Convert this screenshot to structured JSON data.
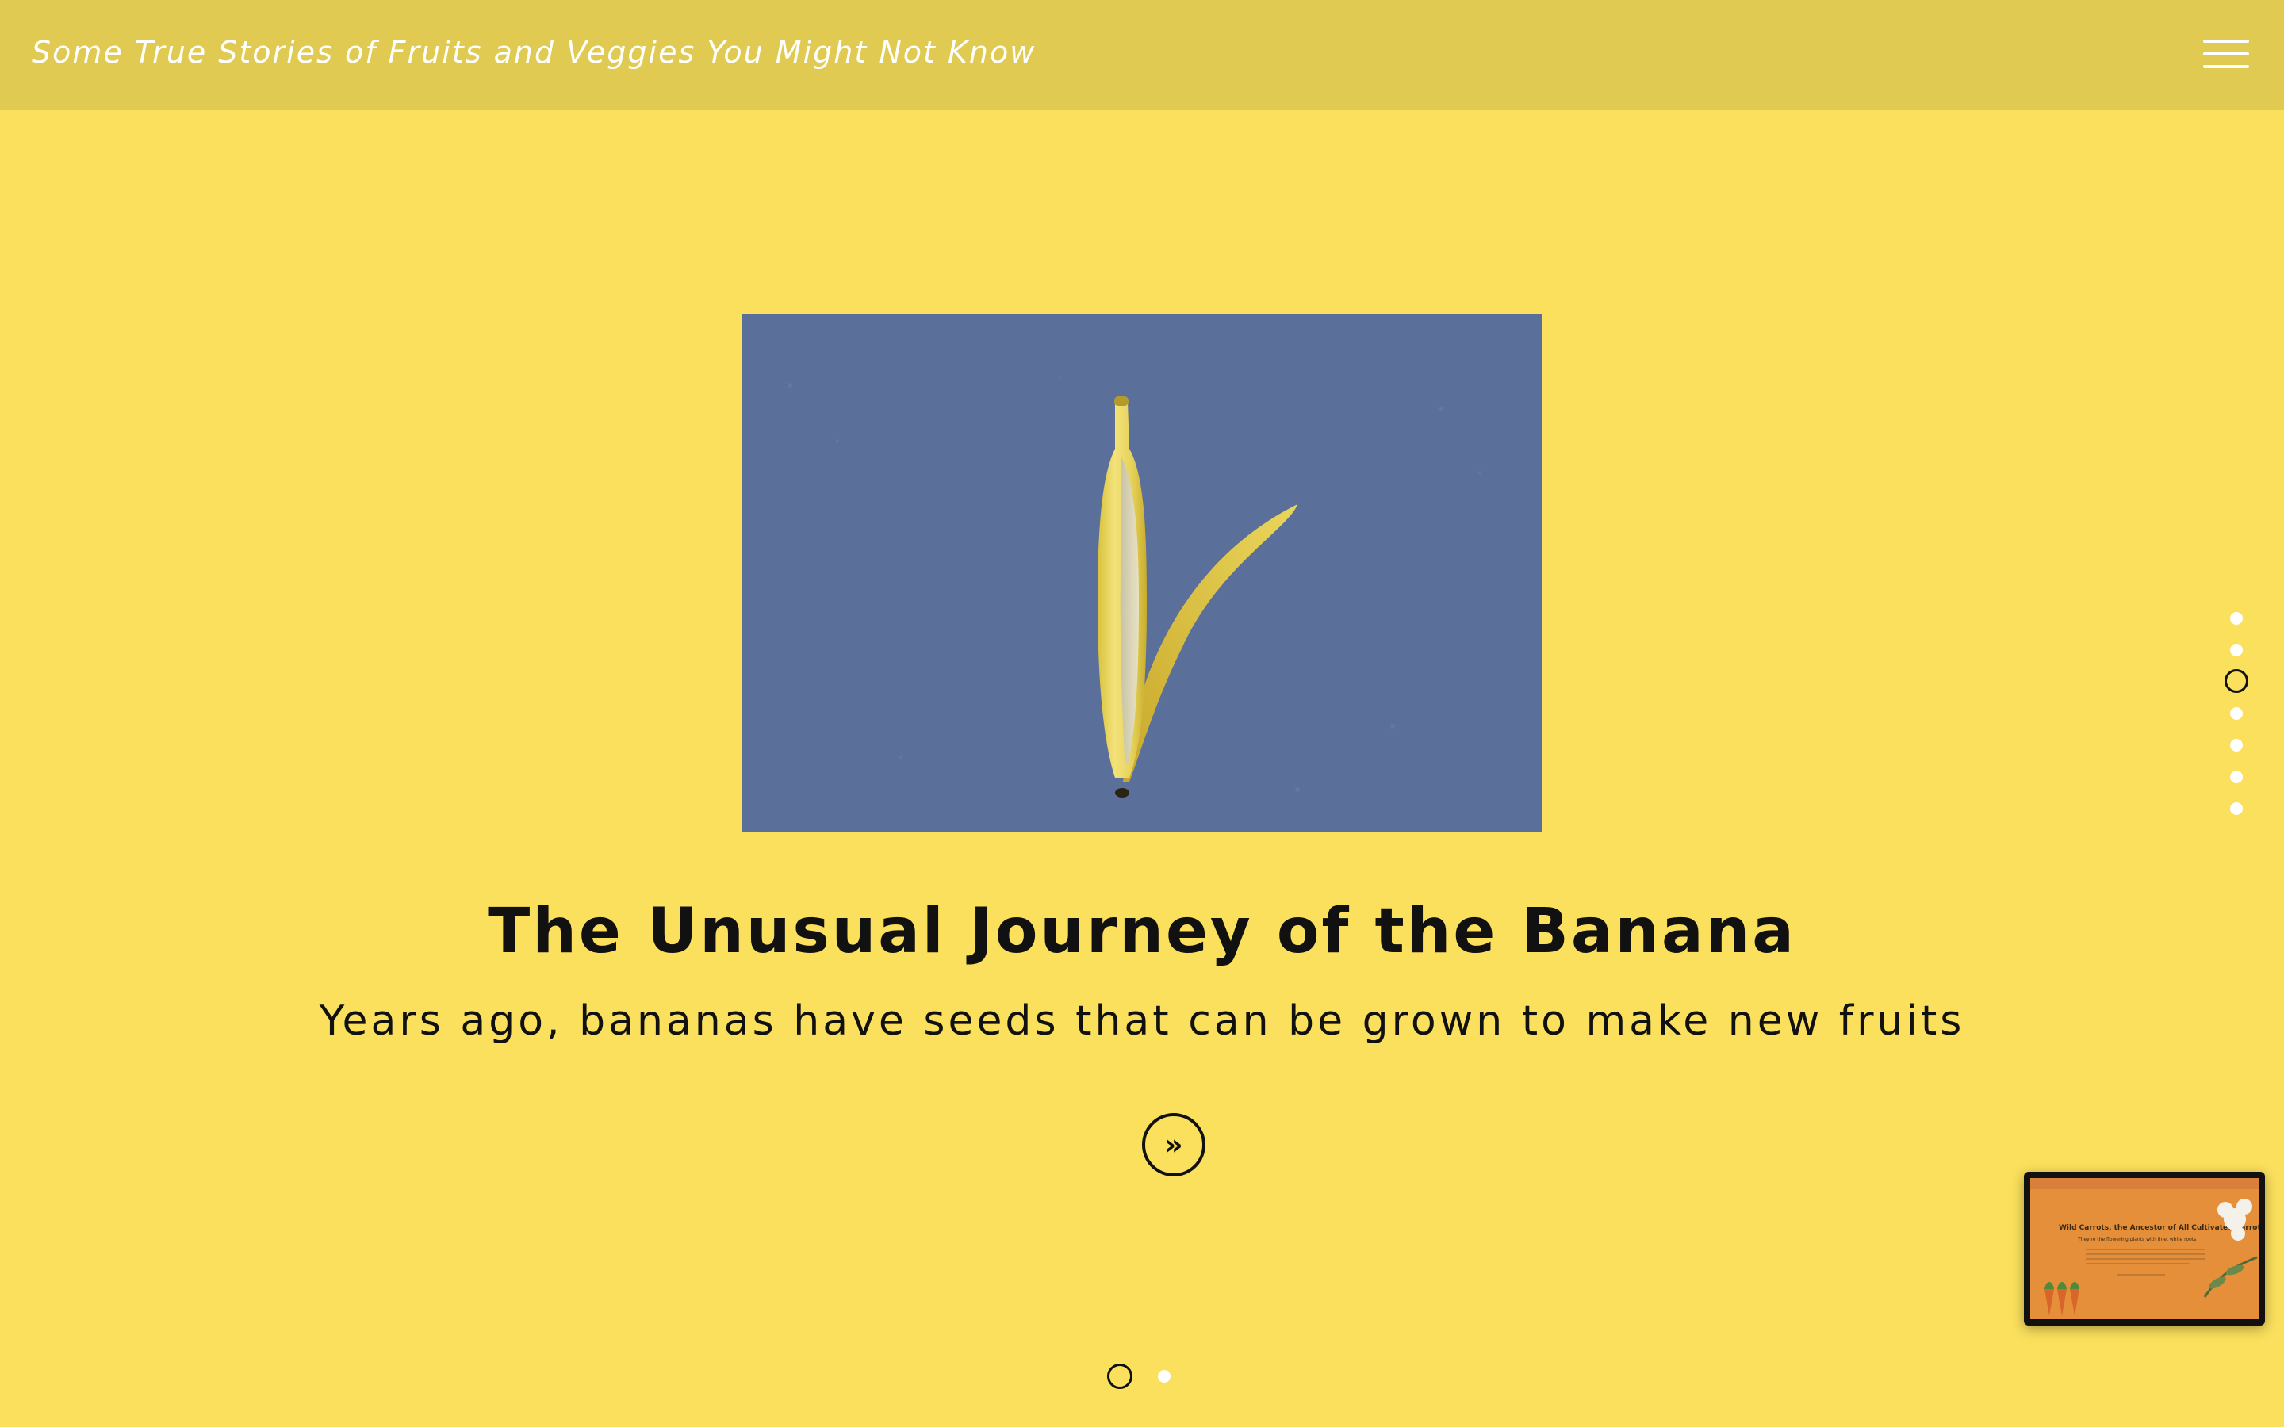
{
  "header": {
    "site_title": "Some True Stories of Fruits and Veggies You Might Not Know",
    "menu_icon": "hamburger-menu-icon"
  },
  "story": {
    "title": "The Unusual Journey of the Banana",
    "subtitle": "Years ago, bananas have seeds that can be grown to make new fruits",
    "next_icon": "double-chevron-right-icon",
    "next_label": "»"
  },
  "side_nav": {
    "count": 7,
    "active_index": 2
  },
  "bottom_nav": {
    "count": 2,
    "active_index": 0
  },
  "preview": {
    "title": "Wild Carrots, the Ancestor of All Cultivated Carrots",
    "subtitle": "They're the flowering plants with fine, white roots"
  },
  "colors": {
    "background": "#fbe05d",
    "header": "#e0ca52",
    "image_background": "#5a6f99",
    "preview_background": "#e58f3a"
  }
}
